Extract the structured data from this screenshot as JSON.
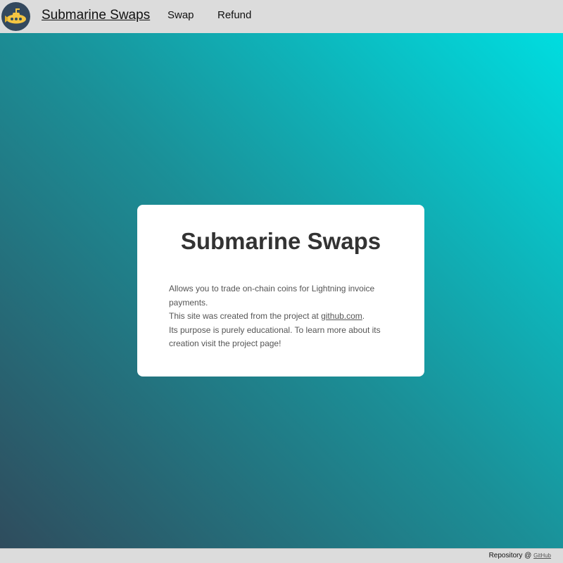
{
  "header": {
    "logo_icon": "submarine-icon",
    "brand": "Submarine Swaps",
    "nav": {
      "swap_label": "Swap",
      "refund_label": "Refund"
    }
  },
  "card": {
    "title": "Submarine Swaps",
    "line1": "Allows you to trade on-chain coins for Lightning invoice payments.",
    "line2_prefix": "This site was created from the project at ",
    "line2_link": "github.com",
    "line2_suffix": ".",
    "line3": "Its purpose is purely educational. To learn more about its creation visit the project page!"
  },
  "footer": {
    "prefix": "Repository @ ",
    "link": "GitHub"
  },
  "colors": {
    "bar_bg": "#dcdcdc",
    "logo_bg": "#34495e",
    "submarine_yellow": "#f4c542",
    "gradient_start": "#2f4c5d",
    "gradient_end": "#00dde0",
    "card_bg": "#ffffff",
    "title_color": "#333333"
  }
}
